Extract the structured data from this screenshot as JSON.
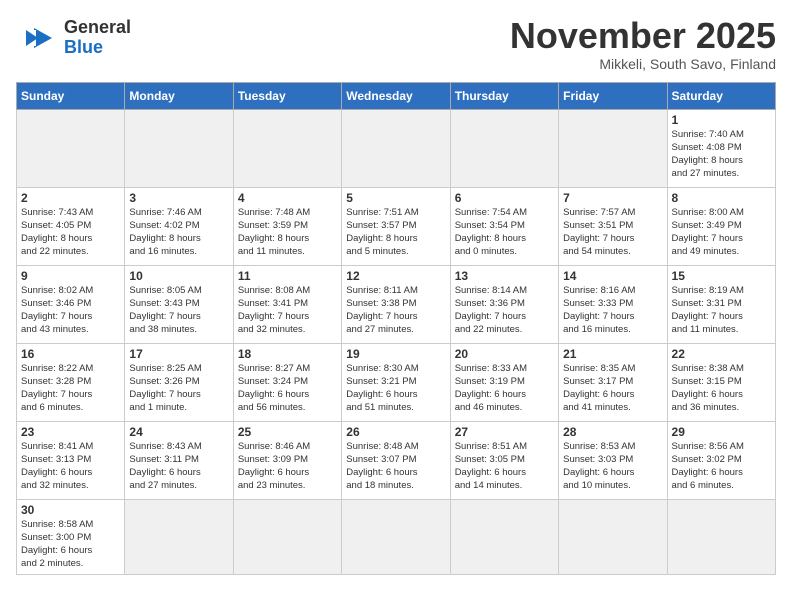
{
  "header": {
    "logo_general": "General",
    "logo_blue": "Blue",
    "month_title": "November 2025",
    "location": "Mikkeli, South Savo, Finland"
  },
  "weekdays": [
    "Sunday",
    "Monday",
    "Tuesday",
    "Wednesday",
    "Thursday",
    "Friday",
    "Saturday"
  ],
  "weeks": [
    [
      {
        "day": "",
        "info": ""
      },
      {
        "day": "",
        "info": ""
      },
      {
        "day": "",
        "info": ""
      },
      {
        "day": "",
        "info": ""
      },
      {
        "day": "",
        "info": ""
      },
      {
        "day": "",
        "info": ""
      },
      {
        "day": "1",
        "info": "Sunrise: 7:40 AM\nSunset: 4:08 PM\nDaylight: 8 hours\nand 27 minutes."
      }
    ],
    [
      {
        "day": "2",
        "info": "Sunrise: 7:43 AM\nSunset: 4:05 PM\nDaylight: 8 hours\nand 22 minutes."
      },
      {
        "day": "3",
        "info": "Sunrise: 7:46 AM\nSunset: 4:02 PM\nDaylight: 8 hours\nand 16 minutes."
      },
      {
        "day": "4",
        "info": "Sunrise: 7:48 AM\nSunset: 3:59 PM\nDaylight: 8 hours\nand 11 minutes."
      },
      {
        "day": "5",
        "info": "Sunrise: 7:51 AM\nSunset: 3:57 PM\nDaylight: 8 hours\nand 5 minutes."
      },
      {
        "day": "6",
        "info": "Sunrise: 7:54 AM\nSunset: 3:54 PM\nDaylight: 8 hours\nand 0 minutes."
      },
      {
        "day": "7",
        "info": "Sunrise: 7:57 AM\nSunset: 3:51 PM\nDaylight: 7 hours\nand 54 minutes."
      },
      {
        "day": "8",
        "info": "Sunrise: 8:00 AM\nSunset: 3:49 PM\nDaylight: 7 hours\nand 49 minutes."
      }
    ],
    [
      {
        "day": "9",
        "info": "Sunrise: 8:02 AM\nSunset: 3:46 PM\nDaylight: 7 hours\nand 43 minutes."
      },
      {
        "day": "10",
        "info": "Sunrise: 8:05 AM\nSunset: 3:43 PM\nDaylight: 7 hours\nand 38 minutes."
      },
      {
        "day": "11",
        "info": "Sunrise: 8:08 AM\nSunset: 3:41 PM\nDaylight: 7 hours\nand 32 minutes."
      },
      {
        "day": "12",
        "info": "Sunrise: 8:11 AM\nSunset: 3:38 PM\nDaylight: 7 hours\nand 27 minutes."
      },
      {
        "day": "13",
        "info": "Sunrise: 8:14 AM\nSunset: 3:36 PM\nDaylight: 7 hours\nand 22 minutes."
      },
      {
        "day": "14",
        "info": "Sunrise: 8:16 AM\nSunset: 3:33 PM\nDaylight: 7 hours\nand 16 minutes."
      },
      {
        "day": "15",
        "info": "Sunrise: 8:19 AM\nSunset: 3:31 PM\nDaylight: 7 hours\nand 11 minutes."
      }
    ],
    [
      {
        "day": "16",
        "info": "Sunrise: 8:22 AM\nSunset: 3:28 PM\nDaylight: 7 hours\nand 6 minutes."
      },
      {
        "day": "17",
        "info": "Sunrise: 8:25 AM\nSunset: 3:26 PM\nDaylight: 7 hours\nand 1 minute."
      },
      {
        "day": "18",
        "info": "Sunrise: 8:27 AM\nSunset: 3:24 PM\nDaylight: 6 hours\nand 56 minutes."
      },
      {
        "day": "19",
        "info": "Sunrise: 8:30 AM\nSunset: 3:21 PM\nDaylight: 6 hours\nand 51 minutes."
      },
      {
        "day": "20",
        "info": "Sunrise: 8:33 AM\nSunset: 3:19 PM\nDaylight: 6 hours\nand 46 minutes."
      },
      {
        "day": "21",
        "info": "Sunrise: 8:35 AM\nSunset: 3:17 PM\nDaylight: 6 hours\nand 41 minutes."
      },
      {
        "day": "22",
        "info": "Sunrise: 8:38 AM\nSunset: 3:15 PM\nDaylight: 6 hours\nand 36 minutes."
      }
    ],
    [
      {
        "day": "23",
        "info": "Sunrise: 8:41 AM\nSunset: 3:13 PM\nDaylight: 6 hours\nand 32 minutes."
      },
      {
        "day": "24",
        "info": "Sunrise: 8:43 AM\nSunset: 3:11 PM\nDaylight: 6 hours\nand 27 minutes."
      },
      {
        "day": "25",
        "info": "Sunrise: 8:46 AM\nSunset: 3:09 PM\nDaylight: 6 hours\nand 23 minutes."
      },
      {
        "day": "26",
        "info": "Sunrise: 8:48 AM\nSunset: 3:07 PM\nDaylight: 6 hours\nand 18 minutes."
      },
      {
        "day": "27",
        "info": "Sunrise: 8:51 AM\nSunset: 3:05 PM\nDaylight: 6 hours\nand 14 minutes."
      },
      {
        "day": "28",
        "info": "Sunrise: 8:53 AM\nSunset: 3:03 PM\nDaylight: 6 hours\nand 10 minutes."
      },
      {
        "day": "29",
        "info": "Sunrise: 8:56 AM\nSunset: 3:02 PM\nDaylight: 6 hours\nand 6 minutes."
      }
    ],
    [
      {
        "day": "30",
        "info": "Sunrise: 8:58 AM\nSunset: 3:00 PM\nDaylight: 6 hours\nand 2 minutes."
      },
      {
        "day": "",
        "info": ""
      },
      {
        "day": "",
        "info": ""
      },
      {
        "day": "",
        "info": ""
      },
      {
        "day": "",
        "info": ""
      },
      {
        "day": "",
        "info": ""
      },
      {
        "day": "",
        "info": ""
      }
    ]
  ]
}
